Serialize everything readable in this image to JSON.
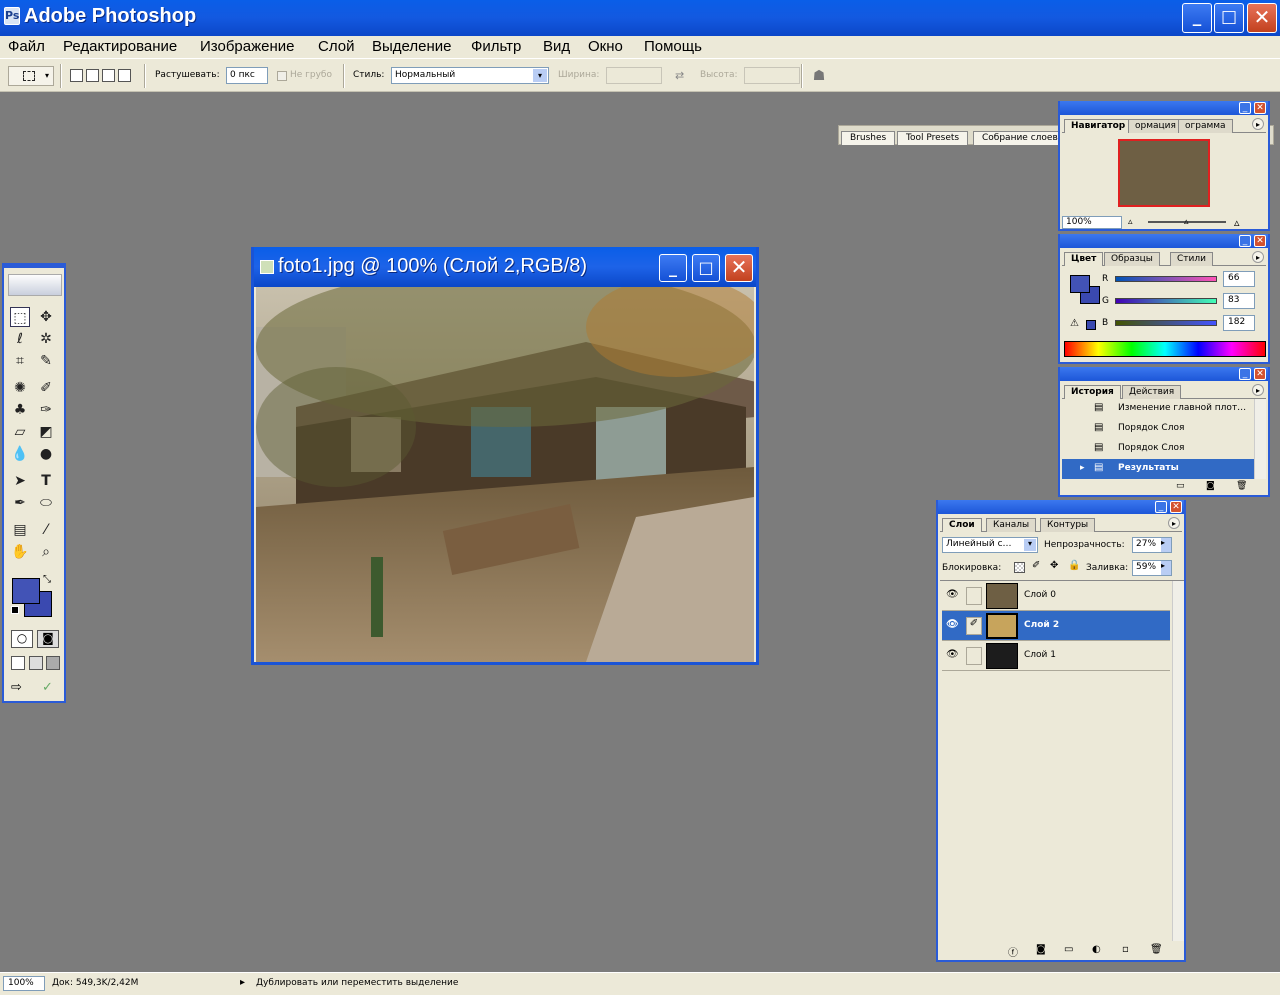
{
  "app": {
    "title": "Adobe Photoshop",
    "icon": "photoshop-icon"
  },
  "window_controls": {
    "minimize": "_",
    "maximize": "□",
    "close": "✕"
  },
  "menu": [
    "Файл",
    "Редактирование",
    "Изображение",
    "Слой",
    "Выделение",
    "Фильтр",
    "Вид",
    "Окно",
    "Помощь"
  ],
  "options": {
    "feather_label": "Растушевать:",
    "feather_value": "0 пкс",
    "antialias_label": "Не грубо",
    "style_label": "Стиль:",
    "style_value": "Нормальный",
    "width_label": "Ширина:",
    "height_label": "Высота:"
  },
  "palette_well": {
    "tabs": [
      "Brushes",
      "Tool Presets",
      "Собрание слоев"
    ]
  },
  "document": {
    "title": "foto1.jpg @ 100% (Слой 2,RGB/8)"
  },
  "navigator": {
    "tabs": [
      "Навигатор",
      "ормация",
      "ограмма"
    ],
    "zoom": "100%"
  },
  "color": {
    "tabs": [
      "Цвет",
      "Образцы",
      "Стили"
    ],
    "channels": [
      {
        "label": "R",
        "value": "66"
      },
      {
        "label": "G",
        "value": "83"
      },
      {
        "label": "B",
        "value": "182"
      }
    ],
    "foreground": "#4253b6",
    "background": "#3a49b0"
  },
  "history": {
    "tabs": [
      "История",
      "Действия"
    ],
    "items": [
      "Изменение главной плот…",
      "Порядок Слоя",
      "Порядок Слоя",
      "Результаты"
    ]
  },
  "layers": {
    "tabs": [
      "Слои",
      "Каналы",
      "Контуры"
    ],
    "blend_mode": "Линейный с…",
    "opacity_label": "Непрозрачность:",
    "opacity_value": "27%",
    "lock_label": "Блокировка:",
    "fill_label": "Заливка:",
    "fill_value": "59%",
    "items": [
      {
        "name": "Слой 0"
      },
      {
        "name": "Слой 2"
      },
      {
        "name": "Слой 1"
      }
    ]
  },
  "status": {
    "zoom": "100%",
    "doc_info": "Док: 549,3K/2,42M",
    "hint": "Дублировать или переместить выделение"
  }
}
